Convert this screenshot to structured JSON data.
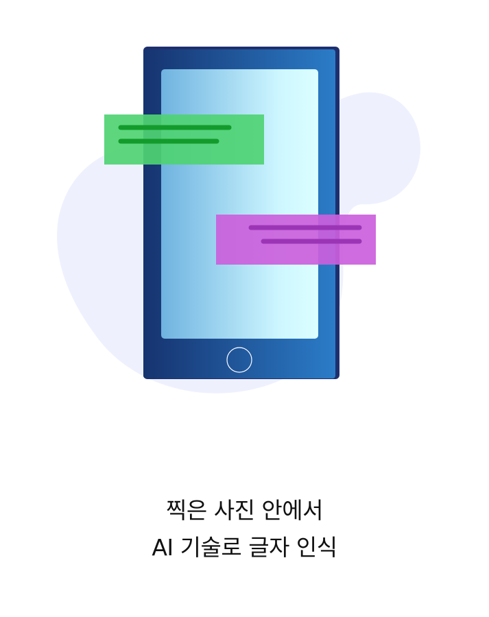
{
  "caption": {
    "line1": "찍은 사진 안에서",
    "line2": "AI 기술로 글자 인식"
  },
  "illustration": {
    "icons": [
      "phone-icon",
      "home-button-icon",
      "text-bubble-icon"
    ],
    "colors": {
      "blob": "#eef1fd",
      "phone_dark": "#16336f",
      "phone_light": "#2b7cc8",
      "screen_left": "#6fb3e0",
      "screen_right": "#dcffff",
      "green_bubble": "#4fd373",
      "green_line": "#139b2c",
      "purple_bubble": "#cb5fdc",
      "purple_line": "#9b35b6"
    }
  }
}
